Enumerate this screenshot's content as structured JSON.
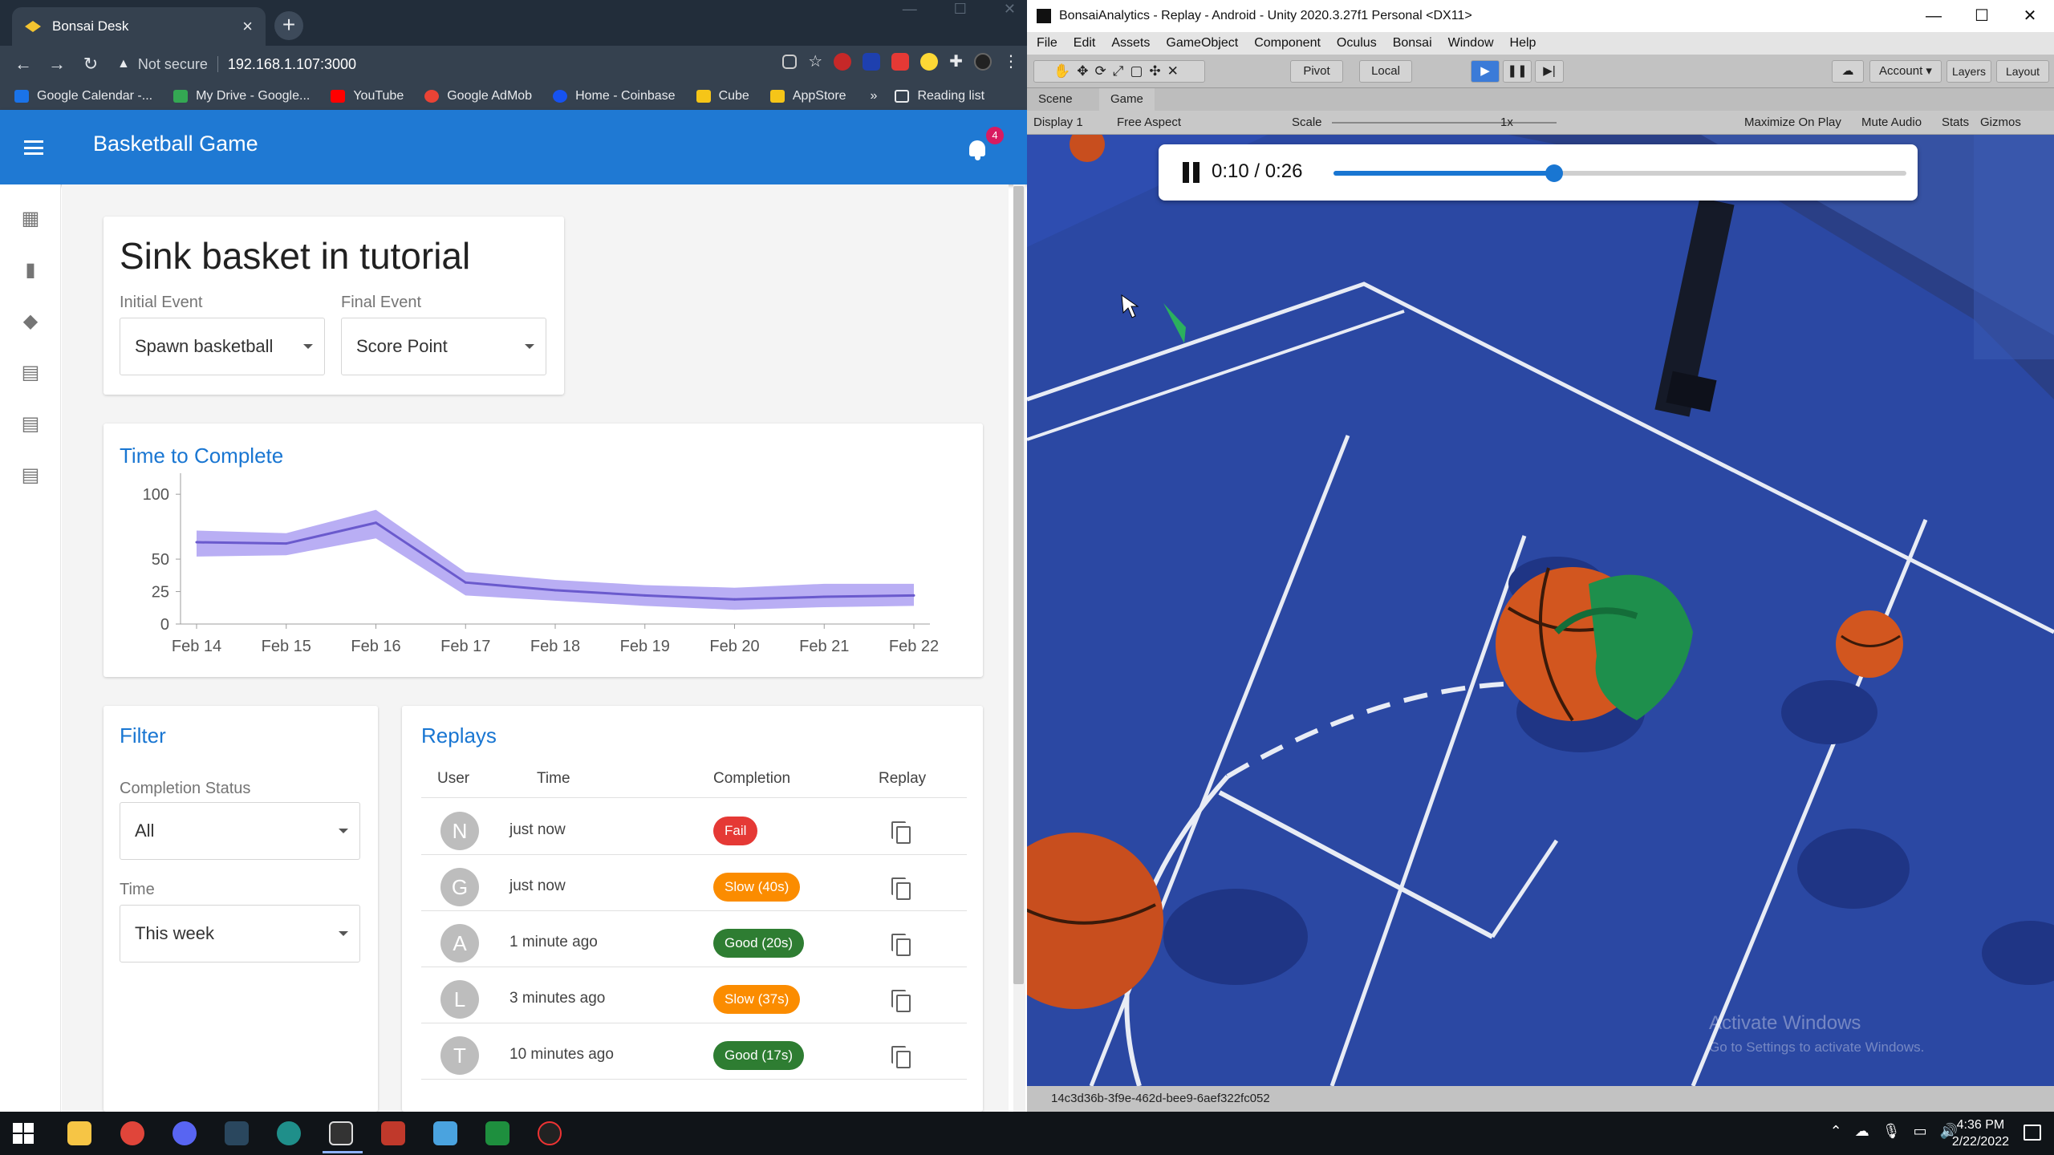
{
  "browser": {
    "tab_title": "Bonsai Desk",
    "new_tab_symbol": "+",
    "close_symbol": "×",
    "security_label": "Not secure",
    "url": "192.168.1.107:3000",
    "bookmarks": [
      {
        "label": "Google Calendar -...",
        "color": "#1a73e8"
      },
      {
        "label": "My Drive - Google...",
        "color": "#34a853"
      },
      {
        "label": "YouTube",
        "color": "#ff0000"
      },
      {
        "label": "Google AdMob",
        "color": "#ea4335"
      },
      {
        "label": "Home - Coinbase",
        "color": "#1652f0"
      },
      {
        "label": "Cube",
        "color": "#f5c518"
      },
      {
        "label": "AppStore",
        "color": "#f5c518"
      }
    ],
    "bookmarks_more": "»",
    "reading_list": "Reading list"
  },
  "app": {
    "title": "Basketball Game",
    "notification_count": "4",
    "accent_color": "#1f79d3",
    "rail_icons": [
      "dashboard-icon",
      "bar-chart-icon",
      "layers-icon",
      "clipboard-icon",
      "clipboard-icon",
      "clipboard-icon"
    ]
  },
  "event_card": {
    "title": "Sink basket in tutorial",
    "initial_label": "Initial Event",
    "initial_value": "Spawn basketball",
    "final_label": "Final Event",
    "final_value": "Score Point"
  },
  "chart_card": {
    "title": "Time to Complete"
  },
  "chart_data": {
    "type": "area",
    "title": "Time to Complete",
    "categories": [
      "Feb 14",
      "Feb 15",
      "Feb 16",
      "Feb 17",
      "Feb 18",
      "Feb 19",
      "Feb 20",
      "Feb 21",
      "Feb 22"
    ],
    "y_ticks": [
      0,
      25,
      50,
      100
    ],
    "ylim": [
      0,
      110
    ],
    "series": [
      {
        "line": [
          63,
          62,
          78,
          32,
          26,
          22,
          19,
          21,
          22
        ],
        "band_upper": [
          72,
          70,
          88,
          40,
          34,
          30,
          28,
          31,
          31
        ],
        "band_lower": [
          52,
          53,
          66,
          22,
          18,
          14,
          11,
          13,
          14
        ]
      }
    ],
    "line_color": "#6a5acd",
    "band_color": "#9b8cf0"
  },
  "filter": {
    "title": "Filter",
    "status_label": "Completion Status",
    "status_value": "All",
    "time_label": "Time",
    "time_value": "This week"
  },
  "replays": {
    "title": "Replays",
    "headers": {
      "user": "User",
      "time": "Time",
      "completion": "Completion",
      "replay": "Replay"
    },
    "rows": [
      {
        "initial": "N",
        "time": "just now",
        "completion": "Fail",
        "color": "#e53935"
      },
      {
        "initial": "G",
        "time": "just now",
        "completion": "Slow (40s)",
        "color": "#fb8c00"
      },
      {
        "initial": "A",
        "time": "1 minute ago",
        "completion": "Good (20s)",
        "color": "#2e7d32"
      },
      {
        "initial": "L",
        "time": "3 minutes ago",
        "completion": "Slow (37s)",
        "color": "#fb8c00"
      },
      {
        "initial": "T",
        "time": "10 minutes ago",
        "completion": "Good (17s)",
        "color": "#2e7d32"
      }
    ]
  },
  "unity": {
    "window_title": "BonsaiAnalytics - Replay - Android - Unity 2020.3.27f1 Personal <DX11>",
    "menu": [
      "File",
      "Edit",
      "Assets",
      "GameObject",
      "Component",
      "Oculus",
      "Bonsai",
      "Window",
      "Help"
    ],
    "pivot": "Pivot",
    "local": "Local",
    "account": "Account",
    "layers": "Layers",
    "layout": "Layout",
    "tab_scene": "Scene",
    "tab_game": "Game",
    "display": "Display 1",
    "aspect": "Free Aspect",
    "scale_label": "Scale",
    "scale_value": "1x",
    "maximize": "Maximize On Play",
    "mute": "Mute Audio",
    "stats": "Stats",
    "gizmos": "Gizmos",
    "status_id": "14c3d36b-3f9e-462d-bee9-6aef322fc052"
  },
  "replay_player": {
    "time_text": "0:10 / 0:26",
    "progress_fraction": 0.385
  },
  "watermark": {
    "line1": "Activate Windows",
    "line2": "Go to Settings to activate Windows."
  },
  "taskbar": {
    "time": "4:36 PM",
    "date": "2/22/2022"
  }
}
